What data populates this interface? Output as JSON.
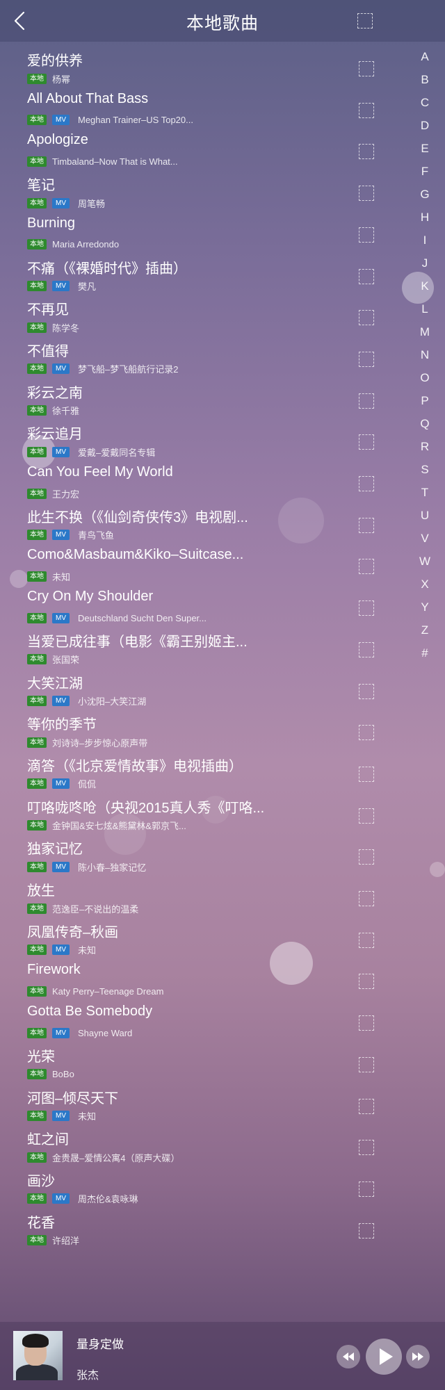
{
  "header": {
    "title": "本地歌曲"
  },
  "badges": {
    "local": "本地",
    "mv": "MV"
  },
  "songs": [
    {
      "title": "爱的供养",
      "artist": "杨幂",
      "mv": false
    },
    {
      "title": "All About That Bass",
      "artist": "Meghan Trainer–US Top20...",
      "mv": true
    },
    {
      "title": "Apologize",
      "artist": "Timbaland–Now That is What...",
      "mv": false
    },
    {
      "title": "笔记",
      "artist": "周笔畅",
      "mv": true
    },
    {
      "title": "Burning",
      "artist": "Maria Arredondo",
      "mv": false
    },
    {
      "title": "不痛（《裸婚时代》插曲）",
      "artist": "樊凡",
      "mv": true
    },
    {
      "title": "不再见",
      "artist": "陈学冬",
      "mv": false
    },
    {
      "title": "不值得",
      "artist": "梦飞船–梦飞船航行记录2",
      "mv": true
    },
    {
      "title": "彩云之南",
      "artist": "徐千雅",
      "mv": false
    },
    {
      "title": "彩云追月",
      "artist": "爱戴–爱戴同名专辑",
      "mv": true
    },
    {
      "title": "Can You Feel My World",
      "artist": "王力宏",
      "mv": false
    },
    {
      "title": "此生不换（《仙剑奇侠传3》电视剧...",
      "artist": "青鸟飞鱼",
      "mv": true
    },
    {
      "title": "Como&Masbaum&Kiko–Suitcase...",
      "artist": "未知",
      "mv": false
    },
    {
      "title": "Cry On My Shoulder",
      "artist": "Deutschland Sucht Den Super...",
      "mv": true
    },
    {
      "title": "当爱已成往事（电影《霸王别姬主...",
      "artist": "张国荣",
      "mv": false
    },
    {
      "title": "大笑江湖",
      "artist": "小沈阳–大笑江湖",
      "mv": true
    },
    {
      "title": "等你的季节",
      "artist": "刘诗诗–步步惊心原声带",
      "mv": false
    },
    {
      "title": "滴答（《北京爱情故事》电视插曲）",
      "artist": "侃侃",
      "mv": true
    },
    {
      "title": "叮咯咙咚呛（央视2015真人秀《叮咯...",
      "artist": "金钟国&安七炫&熊黛林&郭京飞...",
      "mv": false
    },
    {
      "title": "独家记忆",
      "artist": "陈小春–独家记忆",
      "mv": true
    },
    {
      "title": "放生",
      "artist": "范逸臣–不说出的温柔",
      "mv": false
    },
    {
      "title": "凤凰传奇–秋画",
      "artist": "未知",
      "mv": true
    },
    {
      "title": "Firework",
      "artist": "Katy Perry–Teenage Dream",
      "mv": false
    },
    {
      "title": "Gotta Be Somebody",
      "artist": "Shayne Ward",
      "mv": true
    },
    {
      "title": "光荣",
      "artist": "BoBo",
      "mv": false
    },
    {
      "title": "河图–倾尽天下",
      "artist": "未知",
      "mv": true
    },
    {
      "title": "虹之间",
      "artist": "金贵晟–爱情公寓4（原声大碟）",
      "mv": false
    },
    {
      "title": "画沙",
      "artist": "周杰伦&袁咏琳",
      "mv": true
    },
    {
      "title": "花香",
      "artist": "许绍洋",
      "mv": false
    }
  ],
  "index_letters": [
    "A",
    "B",
    "C",
    "D",
    "E",
    "F",
    "G",
    "H",
    "I",
    "J",
    "K",
    "L",
    "M",
    "N",
    "O",
    "P",
    "Q",
    "R",
    "S",
    "T",
    "U",
    "V",
    "W",
    "X",
    "Y",
    "Z",
    "#"
  ],
  "index_active": "K",
  "now_playing": {
    "title": "量身定做",
    "artist": "张杰"
  }
}
